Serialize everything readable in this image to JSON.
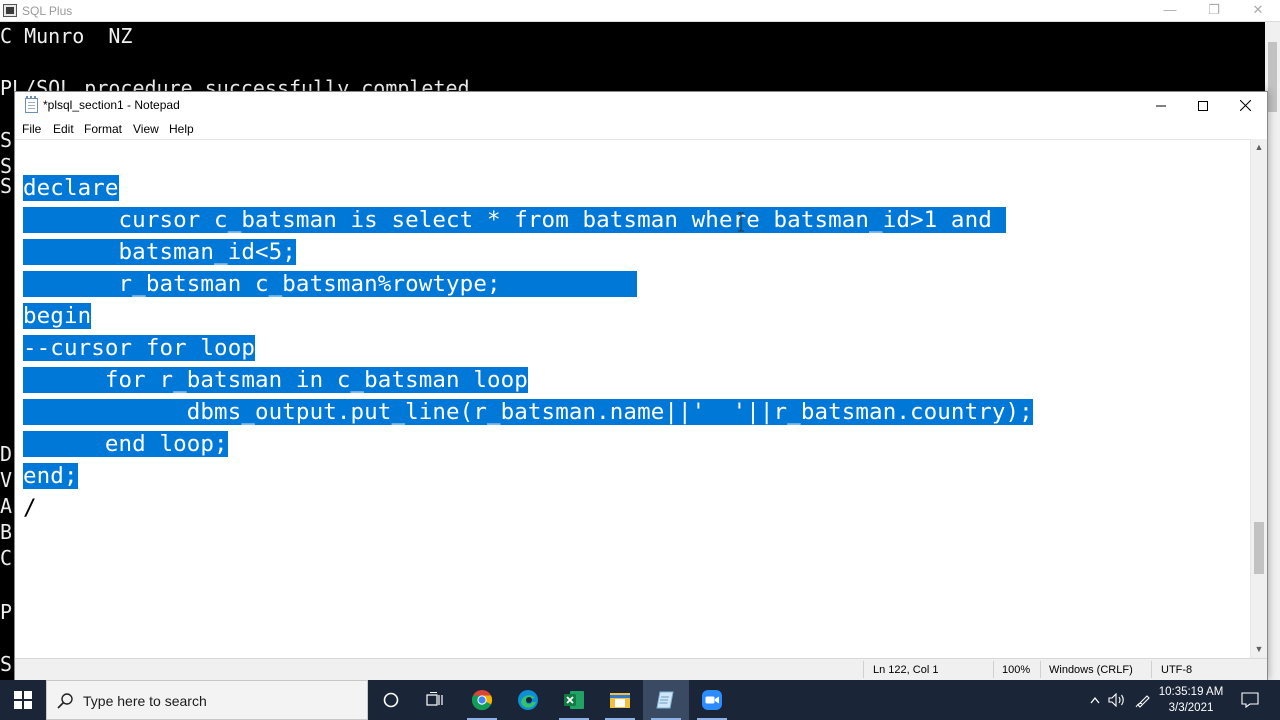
{
  "sqlplus": {
    "title": "SQL Plus",
    "console_lines": [
      {
        "text": "C Munro  NZ",
        "row": 0
      },
      {
        "text": "PL/SQL procedure successfully completed.",
        "row": 2
      }
    ],
    "left_edge_chars": [
      "S",
      "S",
      "S",
      "D",
      "V",
      "A",
      "B",
      "C",
      "P",
      "S"
    ]
  },
  "notepad": {
    "title": "*plsql_section1 - Notepad",
    "menu": [
      "File",
      "Edit",
      "Format",
      "View",
      "Help"
    ],
    "code_lines": [
      "declare",
      "       cursor c_batsman is select * from batsman where batsman_id>1 and ",
      "       batsman_id<5;",
      "       r_batsman c_batsman%rowtype;          ",
      "begin",
      "--cursor for loop",
      "      for r_batsman in c_batsman loop",
      "            dbms_output.put_line(r_batsman.name||'  '||r_batsman.country);",
      "      end loop;",
      "end;"
    ],
    "trailing_line": "/",
    "status": {
      "position": "Ln 122, Col 1",
      "zoom": "100%",
      "line_endings": "Windows (CRLF)",
      "encoding": "UTF-8"
    },
    "selection_color": "#0078d7"
  },
  "taskbar": {
    "search_placeholder": "Type here to search",
    "apps": [
      "task-view-icon",
      "chrome-icon",
      "edge-icon",
      "excel-icon",
      "file-explorer-icon",
      "notepad-icon",
      "zoom-icon"
    ],
    "clock_time": "10:35:19 AM",
    "clock_date": "3/3/2021",
    "background_color": "#1b2538"
  }
}
